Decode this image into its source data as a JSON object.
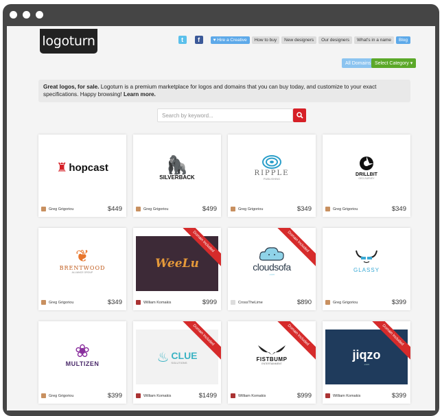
{
  "brand": {
    "logo_text": "logoturn"
  },
  "nav": {
    "twitter": "t",
    "facebook": "f",
    "hire": "Hire a Creative",
    "how": "How to buy",
    "newd": "New designers",
    "ourd": "Our designers",
    "whats": "What's in a name",
    "blog": "Blog"
  },
  "filters": {
    "all": "All Domains",
    "select": "Select Category ▾"
  },
  "intro": {
    "lead": "Great logos, for sale.",
    "body": " Logoturn is a premium marketplace for logos and domains that you can buy today, and customize to your exact specifications. Happy browsing! ",
    "more": "Learn more."
  },
  "search": {
    "placeholder": "Search by keyword..."
  },
  "ribbon": "Domain Included",
  "cards": [
    {
      "title": "hopcast",
      "designer": "Greg Grigoriou",
      "price": "$449"
    },
    {
      "title": "SILVERBACK",
      "designer": "Greg Grigoriou",
      "price": "$499"
    },
    {
      "title": "RIPPLE",
      "sub": "PUBLISHING",
      "designer": "Greg Grigoriou",
      "price": "$349"
    },
    {
      "title": "DRILLBIT",
      "sub": "GEO-SURVEY",
      "designer": "Greg Grigoriou",
      "price": "$349"
    },
    {
      "title": "BRENTWOOD",
      "sub": "ALLIANCE GROUP",
      "designer": "Greg Grigoriou",
      "price": "$349"
    },
    {
      "title": "WeeLu",
      "designer": "William Komakis",
      "price": "$999"
    },
    {
      "title": "cloudsofa",
      "sub": ".com",
      "designer": "CrossTheLime",
      "price": "$890"
    },
    {
      "title": "GLASSY",
      "designer": "Greg Grigoriou",
      "price": "$399"
    },
    {
      "title": "MULTIZEN",
      "designer": "Greg Grigoriou",
      "price": "$399"
    },
    {
      "title": "CLUE",
      "sub": "SOLUTIONS",
      "designer": "William Komakis",
      "price": "$1499"
    },
    {
      "title": "FISTBUMP",
      "sub": "ENTERTAINMENT",
      "designer": "William Komakis",
      "price": "$999"
    },
    {
      "title": "jiqzo",
      "sub": ".com",
      "designer": "William Komakis",
      "price": "$399"
    }
  ],
  "colors": {
    "accent_red": "#d62027",
    "blue": "#5da9e9",
    "green": "#5ba829"
  }
}
